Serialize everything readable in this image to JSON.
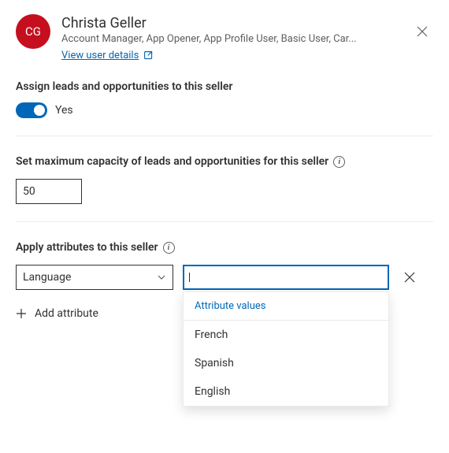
{
  "header": {
    "initials": "CG",
    "name": "Christa Geller",
    "roles": "Account Manager, App Opener, App Profile User, Basic User, Car...",
    "view_details": "View user details"
  },
  "assign": {
    "label": "Assign leads and opportunities to this seller",
    "toggle_value": "Yes"
  },
  "capacity": {
    "label": "Set maximum capacity of leads and opportunities for this seller",
    "value": "50"
  },
  "attributes": {
    "label": "Apply attributes to this seller",
    "selected_key": "Language",
    "combo_value": "",
    "dropdown_header": "Attribute values",
    "options": [
      "French",
      "Spanish",
      "English"
    ],
    "add_label": "Add attribute"
  }
}
